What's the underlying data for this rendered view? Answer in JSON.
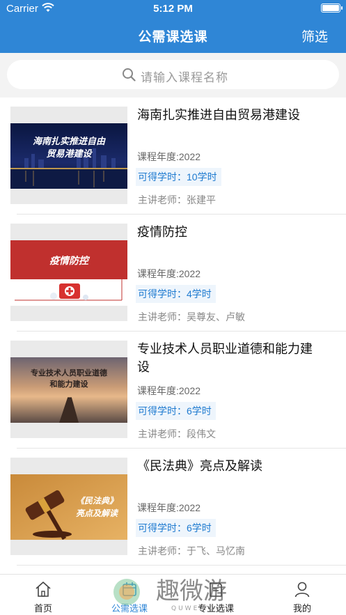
{
  "status_bar": {
    "carrier": "Carrier",
    "time": "5:12 PM"
  },
  "header": {
    "title": "公需课选课",
    "filter_label": "筛选",
    "background": "#2f86d6"
  },
  "search": {
    "placeholder": "请输入课程名称"
  },
  "courses": [
    {
      "title": "海南扎实推进自由贸易港建设",
      "thumb_text": [
        "海南扎实推进自由",
        "贸易港建设"
      ],
      "year": "课程年度:2022",
      "hours": "可得学时：10学时",
      "teacher": "主讲老师：张建平"
    },
    {
      "title": "疫情防控",
      "thumb_text": [
        "疫情防控"
      ],
      "year": "课程年度:2022",
      "hours": "可得学时：4学时",
      "teacher": "主讲老师：吴尊友、卢敏"
    },
    {
      "title": "专业技术人员职业道德和能力建设",
      "thumb_text": [
        "专业技术人员职业道德",
        "和能力建设"
      ],
      "year": "课程年度:2022",
      "hours": "可得学时：6学时",
      "teacher": "主讲老师：段伟文"
    },
    {
      "title": "《民法典》亮点及解读",
      "thumb_text": [
        "《民法典》",
        "亮点及解读"
      ],
      "year": "课程年度:2022",
      "hours": "可得学时：6学时",
      "teacher": "主讲老师：于飞、马忆南"
    }
  ],
  "tabs": [
    {
      "label": "首页",
      "icon": "home-icon"
    },
    {
      "label": "公需选课",
      "icon": "calendar-icon",
      "active": true
    },
    {
      "label": "专业选课",
      "icon": "book-icon"
    },
    {
      "label": "我的",
      "icon": "user-icon"
    }
  ],
  "watermark": {
    "text": "趣微游",
    "subtext": "QUWEIYOU"
  }
}
